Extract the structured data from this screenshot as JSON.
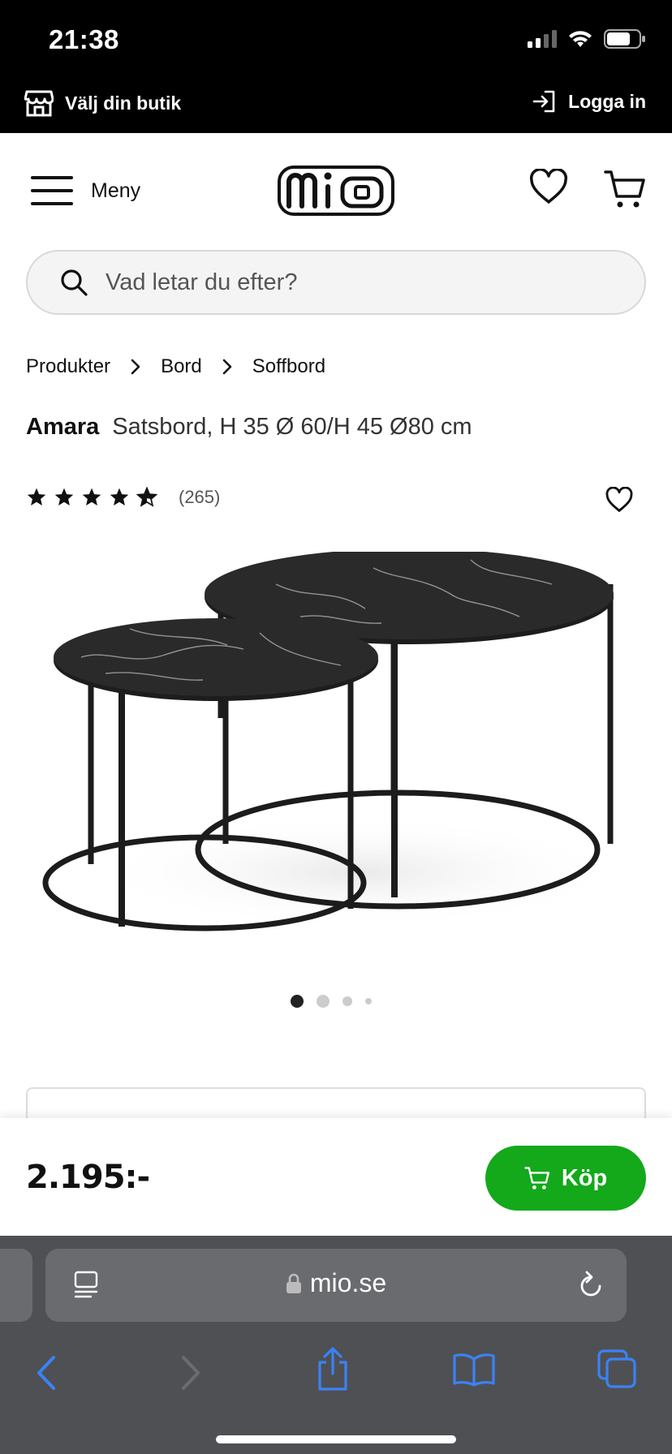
{
  "status_bar": {
    "time": "21:38"
  },
  "store_bar": {
    "store_label": "Välj din butik",
    "login_label": "Logga in"
  },
  "header": {
    "menu_label": "Meny",
    "logo_text": "mio"
  },
  "search": {
    "placeholder": "Vad letar du efter?"
  },
  "breadcrumb": [
    "Produkter",
    "Bord",
    "Soffbord"
  ],
  "product": {
    "brand": "Amara",
    "description": "Satsbord, H 35 Ø 60/H 45 Ø80 cm",
    "rating": 4.5,
    "review_count": "(265)",
    "image_count": 4,
    "active_image": 1
  },
  "buy_bar": {
    "price": "2.195:-",
    "buy_label": "Köp"
  },
  "safari": {
    "url": "mio.se"
  },
  "colors": {
    "accent_green": "#13a91b",
    "bar_black": "#000000",
    "safari_gray": "#4f5054",
    "link_blue": "#3b82f6"
  }
}
